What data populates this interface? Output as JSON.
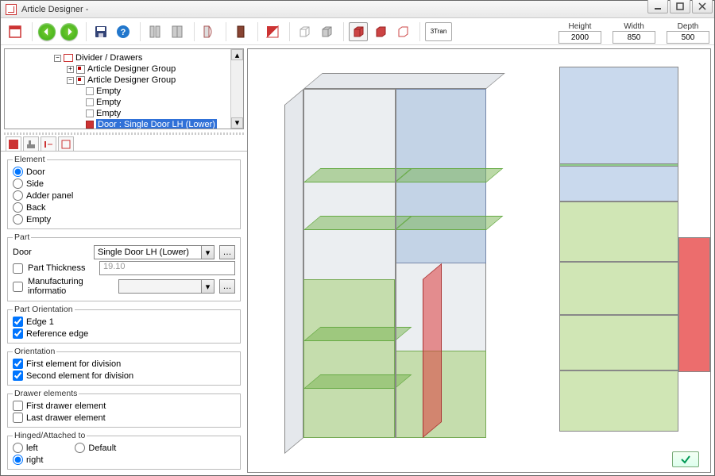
{
  "window": {
    "title": "Article Designer -"
  },
  "dims": {
    "height_label": "Height",
    "height": "2000",
    "width_label": "Width",
    "width": "850",
    "depth_label": "Depth",
    "depth": "500"
  },
  "toolbar": {
    "btn_txt": "3Tran"
  },
  "tree": {
    "root": "Divider / Drawers",
    "group_a": "Article Designer Group",
    "group_b": "Article Designer Group",
    "empty": "Empty",
    "selected": "Door : Single Door LH (Lower)"
  },
  "element": {
    "legend": "Element",
    "door": "Door",
    "side": "Side",
    "adder": "Adder panel",
    "back": "Back",
    "empty": "Empty"
  },
  "part": {
    "legend": "Part",
    "door_label": "Door",
    "door_value": "Single Door LH (Lower)",
    "thickness_label": "Part Thickness",
    "thickness_value": "19.10",
    "manuf_label": "Manufacturing informatio"
  },
  "orient": {
    "legend": "Part Orientation",
    "edge1": "Edge 1",
    "ref": "Reference edge"
  },
  "orientation": {
    "legend": "Orientation",
    "first": "First element for division",
    "second": "Second element for division"
  },
  "drawer": {
    "legend": "Drawer elements",
    "first": "First drawer element",
    "last": "Last drawer element"
  },
  "hinged": {
    "legend": "Hinged/Attached to",
    "left": "left",
    "right": "right",
    "default": "Default"
  }
}
